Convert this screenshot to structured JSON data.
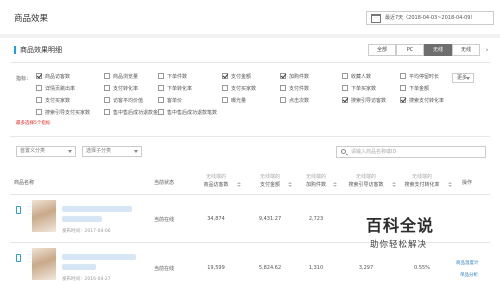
{
  "header": {
    "title": "商品效果",
    "date_range": "最近7天（2018-04-03~2018-04-09）"
  },
  "detail": {
    "section_title": "商品效果明细",
    "device_tabs": [
      "全部",
      "PC",
      "无线",
      "无线"
    ],
    "active_tab": 2,
    "metrics_label": "指标：",
    "metrics": [
      {
        "label": "商品访客数",
        "checked": true
      },
      {
        "label": "商品浏览量",
        "checked": false
      },
      {
        "label": "下单件数",
        "checked": false
      },
      {
        "label": "支付金额",
        "checked": true
      },
      {
        "label": "加购件数",
        "checked": true
      },
      {
        "label": "收藏人数",
        "checked": false
      },
      {
        "label": "平均停留时长",
        "checked": false
      },
      {
        "label": "详情页跳出率",
        "checked": false
      },
      {
        "label": "支付转化率",
        "checked": false
      },
      {
        "label": "下单转化率",
        "checked": false
      },
      {
        "label": "支付买家数",
        "checked": false
      },
      {
        "label": "支付件数",
        "checked": false
      },
      {
        "label": "下单买家数",
        "checked": false
      },
      {
        "label": "下单金额",
        "checked": false
      },
      {
        "label": "支付买家数",
        "checked": false
      },
      {
        "label": "访客平均价值",
        "checked": false
      },
      {
        "label": "客单价",
        "checked": false
      },
      {
        "label": "曝光量",
        "checked": false
      },
      {
        "label": "点击次数",
        "checked": false
      },
      {
        "label": "搜索引导访客数",
        "checked": true
      },
      {
        "label": "搜索支付转化率",
        "checked": true
      },
      {
        "label": "搜索引导支付买家数",
        "checked": false
      },
      {
        "label": "售中售后成功退款金额",
        "checked": false
      },
      {
        "label": "售中售后成功退款笔数",
        "checked": false
      }
    ],
    "more_label": "更多",
    "hint": "最多选择5个指标",
    "filter_category": "首置义分类",
    "filter_subcategory": "选择子分类",
    "search_placeholder": "请输入商品名称或ID"
  },
  "table": {
    "columns": {
      "product": "商品名称",
      "status": "当前状态",
      "visitors": {
        "sub": "无线端的",
        "label": "商品访客数"
      },
      "pay_amount": {
        "sub": "无线端的",
        "label": "支付金额"
      },
      "cart": {
        "sub": "无线端的",
        "label": "加购件数"
      },
      "search_visitors": {
        "sub": "无线端的",
        "label": "搜索引导访客数"
      },
      "search_conv": {
        "sub": "无线端的",
        "label": "搜索支付转化率"
      },
      "ops": "操作"
    },
    "rows": [
      {
        "published": "发布时间：2017-04-06",
        "status": "当前在线",
        "visitors": "34,874",
        "pay_amount": "9,431.27",
        "cart": "2,723",
        "search_visitors": "",
        "search_conv": "",
        "ops": []
      },
      {
        "published": "发布时间：2016-04-27",
        "status": "当前在线",
        "visitors": "19,599",
        "pay_amount": "5,824.62",
        "cart": "1,310",
        "search_visitors": "3,297",
        "search_conv": "0.55%",
        "ops": [
          "商品温度计",
          "单品分析"
        ]
      }
    ]
  },
  "watermark": {
    "logo": "百科全说",
    "tagline": "助你轻松解决"
  }
}
